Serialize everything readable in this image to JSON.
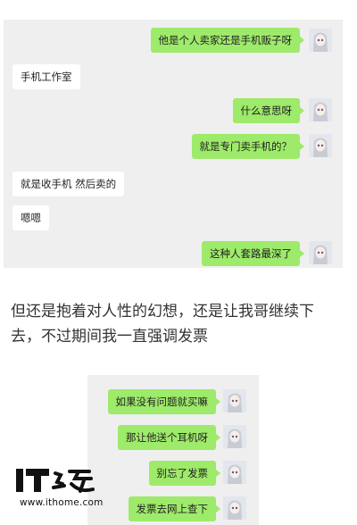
{
  "chat_top": {
    "messages": [
      {
        "side": "out",
        "text": "他是个人卖家还是手机贩子呀"
      },
      {
        "side": "in",
        "text": "手机工作室"
      },
      {
        "side": "out",
        "text": "什么意思呀"
      },
      {
        "side": "out",
        "text": "就是专门卖手机的？"
      },
      {
        "side": "in",
        "text": "就是收手机  然后卖的"
      },
      {
        "side": "in",
        "text": "嗯嗯"
      },
      {
        "side": "out",
        "text": "这种人套路最深了"
      }
    ]
  },
  "article": {
    "paragraph": "但还是抱着对人性的幻想，还是让我哥继续下去，不过期间我一直强调发票"
  },
  "chat_bottom": {
    "messages": [
      {
        "side": "out",
        "text": "如果没有问题就买嘛"
      },
      {
        "side": "out",
        "text": "那让他送个耳机呀"
      },
      {
        "side": "out",
        "text": "别忘了发票"
      },
      {
        "side": "out",
        "text": "发票去网上查下"
      }
    ]
  },
  "watermark": {
    "logo_text": "IT之家",
    "url": "www.ithome.com"
  },
  "colors": {
    "outgoing_bubble": "#9eea6a",
    "incoming_bubble": "#ffffff",
    "chat_background": "#efefef"
  }
}
